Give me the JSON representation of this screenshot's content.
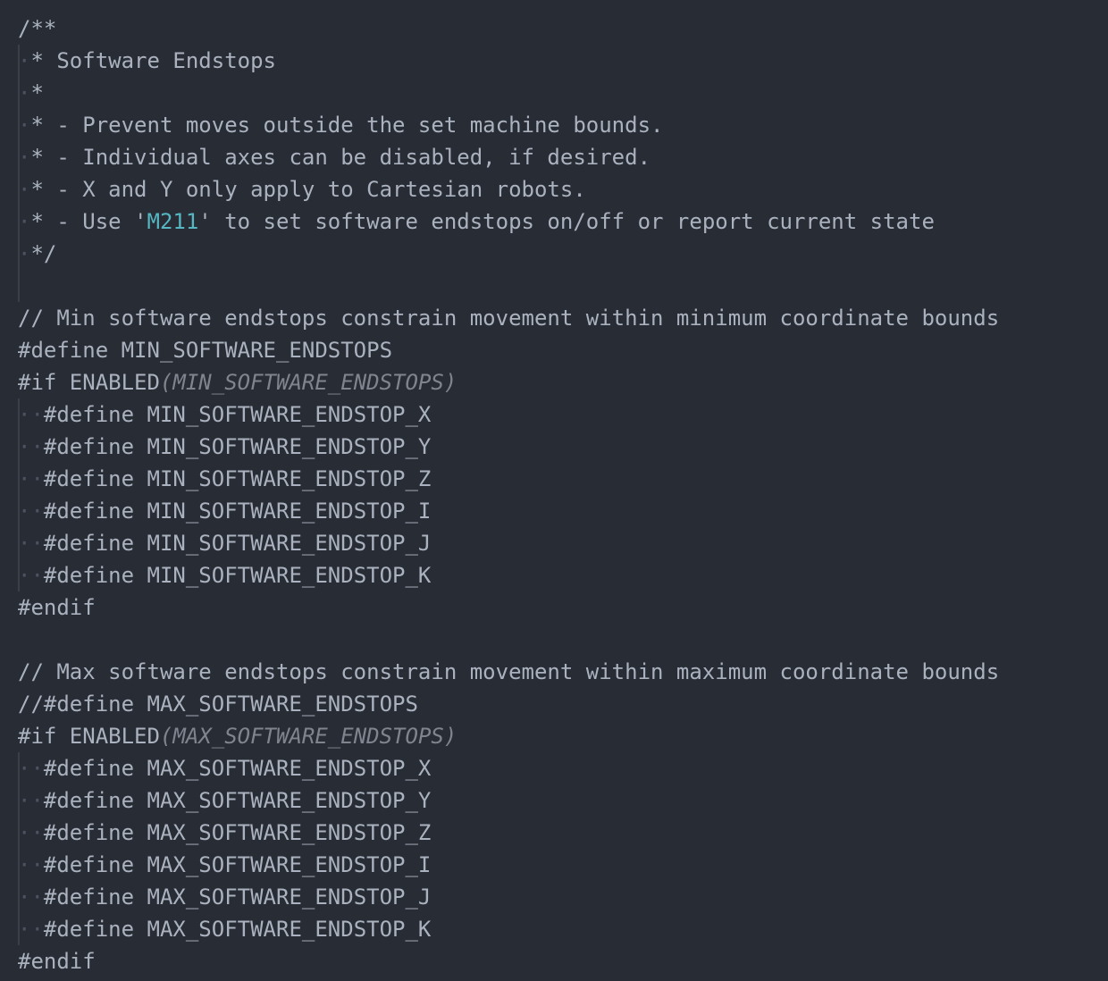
{
  "colors": {
    "background": "#282c34",
    "text": "#abb2bf",
    "string_highlight": "#56b6c2",
    "italic_arg": "#7f848e",
    "indent_guide": "#3b4048",
    "whitespace_dot": "#4b5263"
  },
  "lines": [
    {
      "text": "/**"
    },
    {
      "indent": "·",
      "text": "* Software Endstops"
    },
    {
      "indent": "·",
      "text": "*"
    },
    {
      "indent": "·",
      "text": "* - Prevent moves outside the set machine bounds."
    },
    {
      "indent": "·",
      "text": "* - Individual axes can be disabled, if desired."
    },
    {
      "indent": "·",
      "text": "* - X and Y only apply to Cartesian robots."
    },
    {
      "indent": "·",
      "text": "* - Use '",
      "highlight": "M211",
      "after": "' to set software endstops on/off or report current state"
    },
    {
      "indent": "·",
      "text": "*/"
    },
    {
      "text": ""
    },
    {
      "text": "// Min software endstops constrain movement within minimum coordinate bounds"
    },
    {
      "text": "#define MIN_SOFTWARE_ENDSTOPS"
    },
    {
      "text": "#if ENABLED",
      "dim": "(MIN_SOFTWARE_ENDSTOPS)"
    },
    {
      "indent": "··",
      "text": "#define MIN_SOFTWARE_ENDSTOP_X"
    },
    {
      "indent": "··",
      "text": "#define MIN_SOFTWARE_ENDSTOP_Y"
    },
    {
      "indent": "··",
      "text": "#define MIN_SOFTWARE_ENDSTOP_Z"
    },
    {
      "indent": "··",
      "text": "#define MIN_SOFTWARE_ENDSTOP_I"
    },
    {
      "indent": "··",
      "text": "#define MIN_SOFTWARE_ENDSTOP_J"
    },
    {
      "indent": "··",
      "text": "#define MIN_SOFTWARE_ENDSTOP_K"
    },
    {
      "text": "#endif"
    },
    {
      "text": ""
    },
    {
      "text": "// Max software endstops constrain movement within maximum coordinate bounds"
    },
    {
      "text": "//#define MAX_SOFTWARE_ENDSTOPS"
    },
    {
      "text": "#if ENABLED",
      "dim": "(MAX_SOFTWARE_ENDSTOPS)"
    },
    {
      "indent": "··",
      "text": "#define MAX_SOFTWARE_ENDSTOP_X"
    },
    {
      "indent": "··",
      "text": "#define MAX_SOFTWARE_ENDSTOP_Y"
    },
    {
      "indent": "··",
      "text": "#define MAX_SOFTWARE_ENDSTOP_Z"
    },
    {
      "indent": "··",
      "text": "#define MAX_SOFTWARE_ENDSTOP_I"
    },
    {
      "indent": "··",
      "text": "#define MAX_SOFTWARE_ENDSTOP_J"
    },
    {
      "indent": "··",
      "text": "#define MAX_SOFTWARE_ENDSTOP_K"
    },
    {
      "text": "#endif"
    }
  ]
}
